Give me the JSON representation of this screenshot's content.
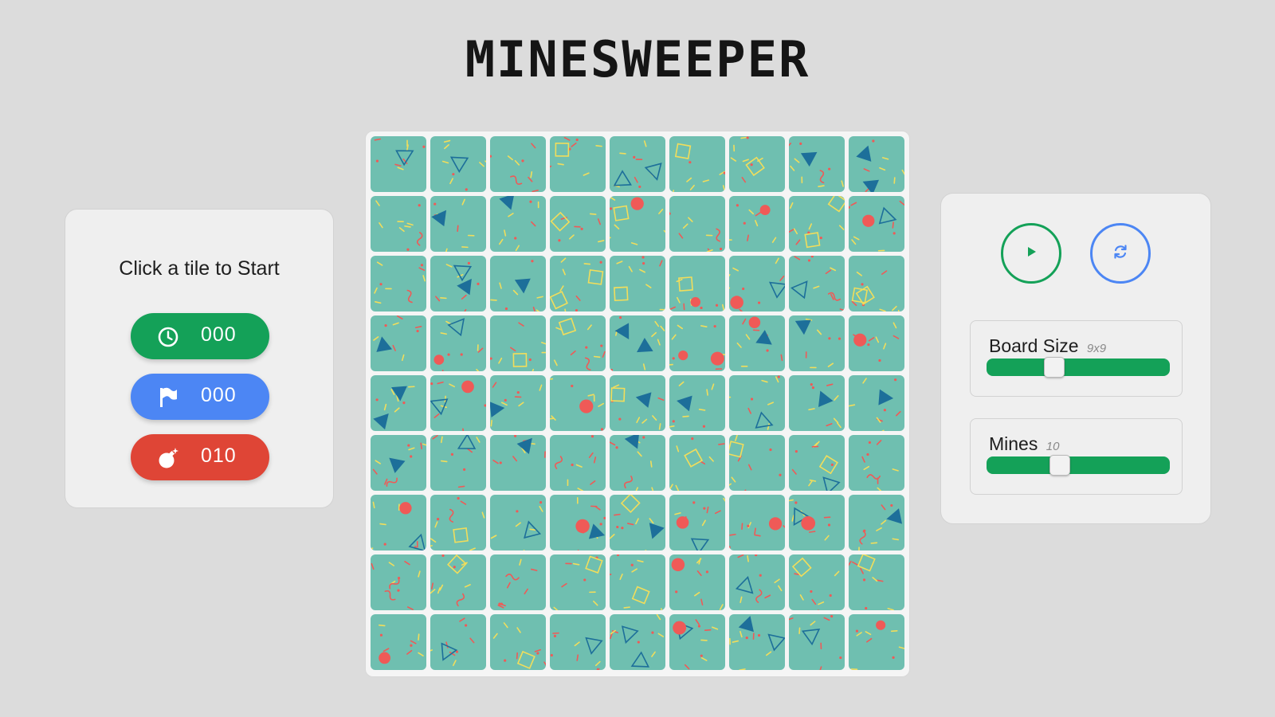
{
  "game": {
    "title": "MINESWEEPER",
    "status": "Click a tile to Start"
  },
  "counters": {
    "timer": {
      "value": "000",
      "icon": "clock-icon",
      "color": "#14a158"
    },
    "flags": {
      "value": "000",
      "icon": "flag-icon",
      "color": "#4c86f4"
    },
    "mines": {
      "value": "010",
      "icon": "bomb-icon",
      "color": "#df4536"
    }
  },
  "board": {
    "rows": 9,
    "cols": 9,
    "tile_color": "#6fbfb0",
    "state": "all-covered"
  },
  "controls": {
    "play": {
      "icon": "play-icon",
      "color": "#14a158"
    },
    "reset": {
      "icon": "refresh-icon",
      "color": "#4c86f4"
    }
  },
  "settings": {
    "board_size": {
      "label": "Board Size",
      "hint": "9x9",
      "fraction": 0.37
    },
    "mines": {
      "label": "Mines",
      "hint": "10",
      "fraction": 0.4
    }
  },
  "palette": {
    "background": "#dcdcdc",
    "panel": "#efefef",
    "green": "#14a158",
    "blue": "#4c86f4",
    "red": "#df4536",
    "tile_teal": "#6fbfb0",
    "shape_red": "#ef5a57",
    "shape_blue": "#1d6f9a",
    "shape_yellow": "#f1dd5b"
  }
}
